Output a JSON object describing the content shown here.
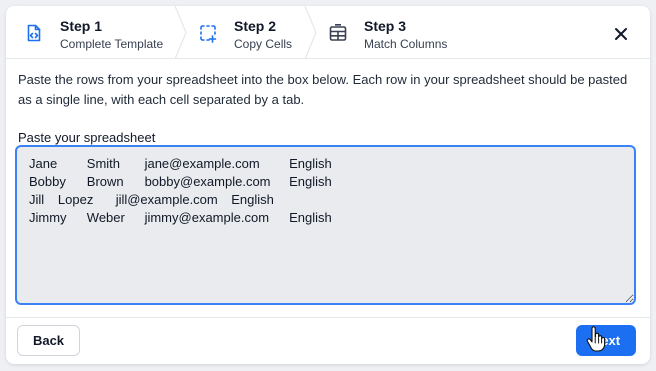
{
  "steps": [
    {
      "title": "Step 1",
      "subtitle": "Complete Template",
      "icon": "file-code-icon"
    },
    {
      "title": "Step 2",
      "subtitle": "Copy Cells",
      "icon": "dashed-select-plus-icon"
    },
    {
      "title": "Step 3",
      "subtitle": "Match Columns",
      "icon": "table-icon"
    }
  ],
  "header": {
    "close_icon": "close-icon"
  },
  "main": {
    "instructions": "Paste the rows from your spreadsheet into the box below. Each row in your spreadsheet should be pasted as a single line, with each cell separated by a tab.",
    "field_label": "Paste your spreadsheet",
    "paste_value": "Jane\tSmith\tjane@example.com\tEnglish\nBobby\tBrown\tbobby@example.com\tEnglish\nJill\tLopez\tjill@example.com\tEnglish\nJimmy\tWeber\tjimmy@example.com\tEnglish"
  },
  "footer": {
    "back_label": "Back",
    "next_label": "Next"
  },
  "colors": {
    "accent": "#1d6ff2",
    "focus_border": "#3b82f6",
    "field_bg": "#e9ebee"
  }
}
